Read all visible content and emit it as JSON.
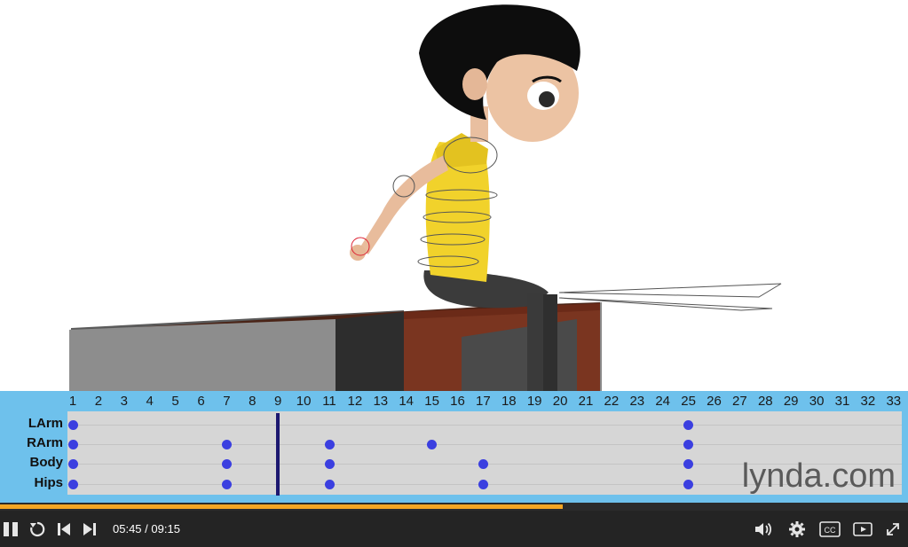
{
  "timeline": {
    "frames": [
      "1",
      "2",
      "3",
      "4",
      "5",
      "6",
      "7",
      "8",
      "9",
      "10",
      "11",
      "12",
      "13",
      "14",
      "15",
      "16",
      "17",
      "18",
      "19",
      "20",
      "21",
      "22",
      "23",
      "24",
      "25",
      "26",
      "27",
      "28",
      "29",
      "30",
      "31",
      "32",
      "33"
    ],
    "tracks": [
      {
        "label": "LArm",
        "keys": [
          1,
          25
        ]
      },
      {
        "label": "RArm",
        "keys": [
          1,
          7,
          11,
          15,
          25
        ]
      },
      {
        "label": "Body",
        "keys": [
          1,
          7,
          11,
          17,
          25
        ]
      },
      {
        "label": "Hips",
        "keys": [
          1,
          7,
          11,
          17,
          25
        ]
      }
    ],
    "current_frame": 9,
    "watermark": "lynda.com"
  },
  "player": {
    "current_time": "05:45",
    "separator": "/",
    "duration": "09:15",
    "progress": 0.62,
    "accent_color": "#f5a623",
    "icons": [
      "pause-icon",
      "replay-icon",
      "previous-icon",
      "next-icon",
      "volume-icon",
      "settings-icon",
      "closed-captions-icon",
      "picture-in-picture-icon",
      "fullscreen-icon"
    ]
  }
}
